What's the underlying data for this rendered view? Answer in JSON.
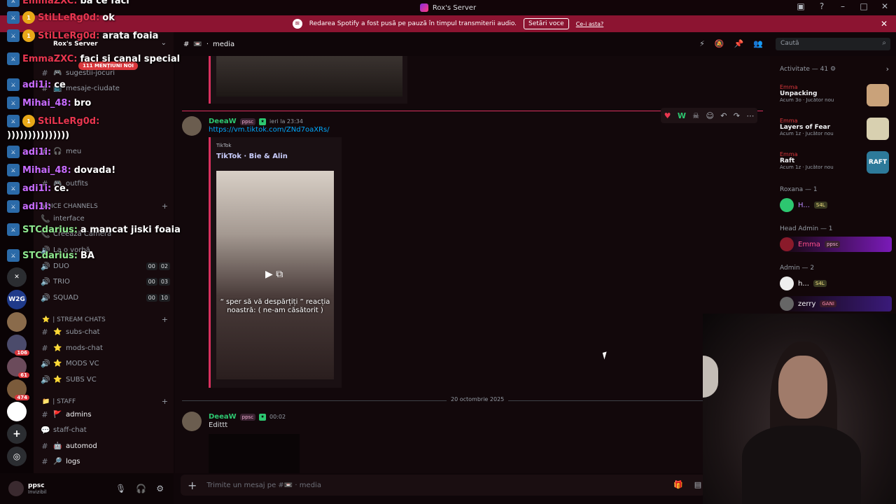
{
  "window": {
    "title": "Rox's Server"
  },
  "banner": {
    "text": "Redarea Spotify a fost pusă pe pauză în timpul transmiterii audio.",
    "button": "Setări voce",
    "link": "Ce-i asta?"
  },
  "servers": [
    {
      "label": "",
      "color": "#2b2d31",
      "badge": ""
    },
    {
      "label": "W2G",
      "color": "#1f3a8a",
      "badge": ""
    },
    {
      "label": "",
      "color": "#8a6b4b",
      "badge": ""
    },
    {
      "label": "",
      "color": "#4b4b6b",
      "badge": "106"
    },
    {
      "label": "",
      "color": "#6b4b5b",
      "badge": "61"
    },
    {
      "label": "",
      "color": "#7b5b3b",
      "badge": "474"
    },
    {
      "label": "",
      "color": "#fff",
      "badge": ""
    }
  ],
  "sidebar": {
    "server_name": "Rox's Server",
    "mentions_pill": "111 MENȚIUNI NOI",
    "channels_top": [
      {
        "icon": "#",
        "emoji": "🎮",
        "label": "sugestii-jocuri"
      },
      {
        "icon": "#",
        "emoji": "📺",
        "label": "mesaje-ciudate"
      },
      {
        "icon": "#",
        "emoji": "🎧",
        "label": "meu"
      },
      {
        "icon": "#",
        "emoji": "🎮",
        "label": "outfits"
      }
    ],
    "voice_category": "VOICE CHANNELS",
    "voice_channels": [
      {
        "icon": "📞",
        "label": "interface"
      },
      {
        "icon": "📞",
        "label": "Creează Cameră"
      },
      {
        "icon": "🔊",
        "label": "La o vorbă"
      },
      {
        "icon": "🔊",
        "label": "DUO",
        "c1": "00",
        "c2": "02"
      },
      {
        "icon": "🔊",
        "label": "TRIO",
        "c1": "00",
        "c2": "03"
      },
      {
        "icon": "🔊",
        "label": "SQUAD",
        "c1": "00",
        "c2": "10"
      }
    ],
    "stream_category": "| STREAM CHATS",
    "stream_channels": [
      {
        "icon": "#",
        "emoji": "⭐",
        "label": "subs-chat"
      },
      {
        "icon": "#",
        "emoji": "⭐",
        "label": "mods-chat"
      },
      {
        "icon": "🔊",
        "emoji": "⭐",
        "label": "MODS VC"
      },
      {
        "icon": "🔊",
        "emoji": "⭐",
        "label": "SUBS VC"
      }
    ],
    "staff_category": "| STAFF",
    "staff_channels": [
      {
        "icon": "#",
        "emoji": "🚩",
        "label": "admins"
      },
      {
        "icon": "💬",
        "emoji": "",
        "label": "staff-chat"
      },
      {
        "icon": "#",
        "emoji": "🤖",
        "label": "automod"
      },
      {
        "icon": "#",
        "emoji": "🔎",
        "label": "logs"
      }
    ]
  },
  "user": {
    "name": "ppsc",
    "status": "Invizibil"
  },
  "chat": {
    "channel": "media",
    "channel_emoji": "📼",
    "search_placeholder": "Caută"
  },
  "messages": [
    {
      "author": "DeeaW",
      "tag": "ppsc",
      "time": "ieri la 23:34",
      "link": "https://vm.tiktok.com/ZNd7oaXRs/",
      "embed": {
        "provider": "TikTok",
        "title": "TikTok · Bie & Alin",
        "caption": "“ sper să vă despărțiți ” reacția noastră: ( ne-am căsătorit )"
      }
    },
    {
      "author": "DeeaW",
      "tag": "ppsc",
      "time": "00:02",
      "text": "Edittt"
    }
  ],
  "date_divider": "20 octombrie 2025",
  "composer": {
    "placeholder": "Trimite un mesaj pe #📼 · media"
  },
  "members": {
    "activity_header": "Activitate — 41",
    "activities": [
      {
        "who": "Emma",
        "game": "Unpacking",
        "meta": "Acum 3o · Jucător nou",
        "color": "#c9a27a"
      },
      {
        "who": "Emma",
        "game": "Layers of Fear",
        "meta": "Acum 1z · Jucător nou",
        "color": "#d8d0b0"
      },
      {
        "who": "Emma",
        "game": "Raft",
        "meta": "Acum 1z · Jucător nou",
        "color": "#2d7a9a"
      }
    ],
    "roles": [
      {
        "name": "Roxana — 1",
        "members": [
          {
            "name": "H...",
            "tag": "S4L",
            "color": "#b98aff"
          }
        ]
      },
      {
        "name": "Head Admin — 1",
        "members": [
          {
            "name": "Emma",
            "tag": "ppsc",
            "color": "#ff4f8b"
          }
        ]
      },
      {
        "name": "Admin — 2",
        "members": [
          {
            "name": "h...",
            "tag": "S4L",
            "color": "#f2f3f5"
          },
          {
            "name": "zerry",
            "tag": "GANI",
            "color": "#f2f3f5"
          }
        ]
      }
    ]
  },
  "overlay_chat": [
    {
      "user": "EmmaZXC:",
      "msg": "ba ce faci"
    },
    {
      "user": "StiLLeRg0d:",
      "msg": "ok"
    },
    {
      "user": "StiLLeRg0d:",
      "msg": "arata foaia"
    },
    {
      "user": "EmmaZXC:",
      "msg": "faci si canal special"
    },
    {
      "user": "adi1i:",
      "msg": "ce"
    },
    {
      "user": "Mihai_48:",
      "msg": "bro"
    },
    {
      "user": "StiLLeRg0d:",
      "msg": ")))))))))))))))"
    },
    {
      "user": "adi1i:",
      "msg": ""
    },
    {
      "user": "Mihai_48:",
      "msg": "dovada!"
    },
    {
      "user": "adi1i:",
      "msg": "ce."
    },
    {
      "user": "adi1i:",
      "msg": ""
    },
    {
      "user": "STCdarius:",
      "msg": "a mancat jiski foaia"
    },
    {
      "user": "STCdarius:",
      "msg": "BA"
    }
  ]
}
